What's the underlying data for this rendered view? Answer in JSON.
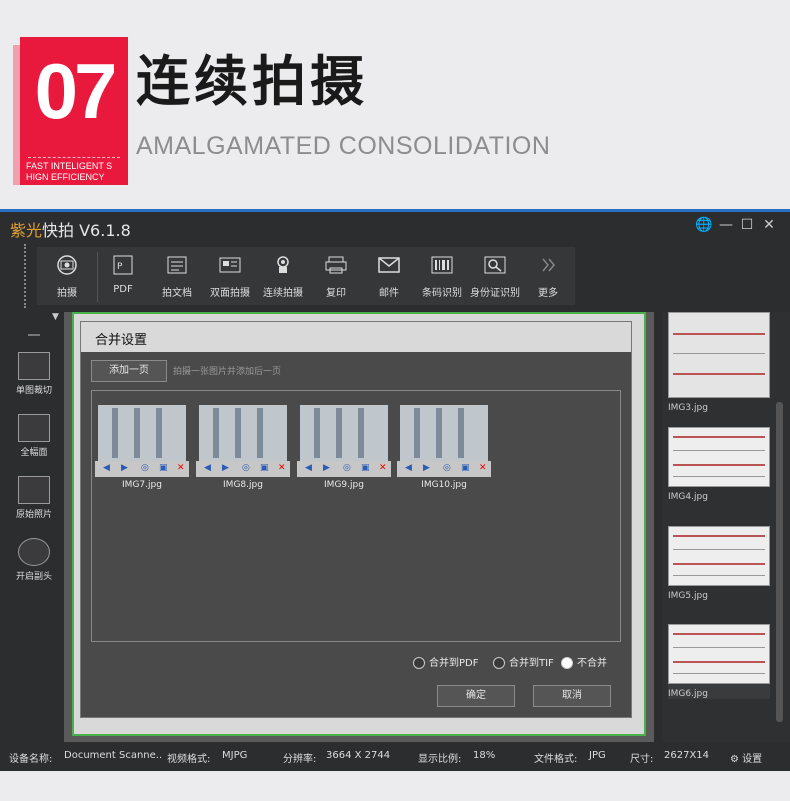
{
  "banner": {
    "number": "07",
    "sub_line1": "FAST INTELIGENT S",
    "sub_line2": "HIGN EFFICIENCY",
    "title": "连续拍摄",
    "subtitle": "AMALGAMATED CONSOLIDATION",
    "accent_color": "#e8193d"
  },
  "app": {
    "brand": "紫光",
    "title": "快拍 V6.1.8",
    "window_buttons": [
      "🌐",
      "—",
      "☐",
      "✕"
    ]
  },
  "toolbar": {
    "items": [
      {
        "label": "拍摄",
        "icon": "camera-icon"
      },
      {
        "label": "PDF",
        "icon": "pdf-icon"
      },
      {
        "label": "拍文档",
        "icon": "document-icon"
      },
      {
        "label": "双面拍摄",
        "icon": "double-side-icon"
      },
      {
        "label": "连续拍摄",
        "icon": "continuous-shoot-icon"
      },
      {
        "label": "复印",
        "icon": "copy-icon"
      },
      {
        "label": "邮件",
        "icon": "mail-icon"
      },
      {
        "label": "条码识别",
        "icon": "barcode-icon"
      },
      {
        "label": "身份证识别",
        "icon": "id-card-icon"
      },
      {
        "label": "更多",
        "icon": "more-icon"
      }
    ]
  },
  "left_panel": {
    "items": [
      {
        "label": "单图裁切"
      },
      {
        "label": "全幅面"
      },
      {
        "label": "原始照片"
      },
      {
        "label": "开启副头"
      }
    ]
  },
  "dialog": {
    "title": "合并设置",
    "add_page": "添加一页",
    "hint": "拍摄一张图片并添加后一页",
    "images": [
      "IMG7.jpg",
      "IMG8.jpg",
      "IMG9.jpg",
      "IMG10.jpg"
    ],
    "options": [
      "合并到PDF",
      "合并到TIF",
      "不合并"
    ],
    "selected_option": "不合并",
    "ok": "确定",
    "cancel": "取消"
  },
  "thumbnails": [
    "IMG3.jpg",
    "IMG4.jpg",
    "IMG5.jpg",
    "IMG6.jpg"
  ],
  "status": {
    "device_label": "设备名称:",
    "device_value": "Document Scanne..",
    "video_label": "视频格式:",
    "video_value": "MJPG",
    "res_label": "分辨率:",
    "res_value": "3664 X 2744",
    "ratio_label": "显示比例:",
    "ratio_value": "18%",
    "fmt_label": "文件格式:",
    "fmt_value": "JPG",
    "size_label": "尺寸:",
    "size_value": "2627X14",
    "settings": "设置"
  }
}
